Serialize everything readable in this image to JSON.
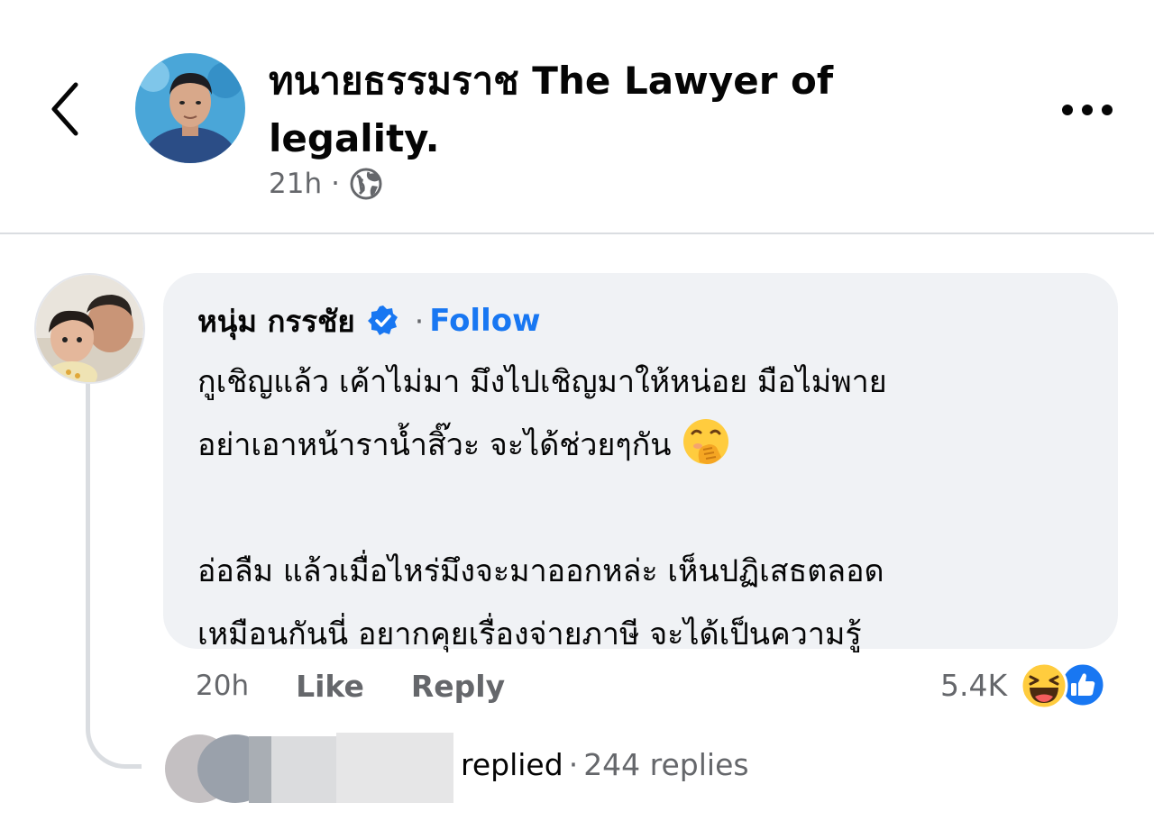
{
  "header": {
    "page_name": "ทนายธรรมราช The Lawyer of legality.",
    "time": "21h",
    "separator": "·",
    "audience_icon": "globe-icon",
    "back_icon": "chevron-left-icon",
    "more_icon": "more-horizontal-icon"
  },
  "comment": {
    "author": "หนุ่ม กรรชัย",
    "verified_icon": "verified-badge-icon",
    "separator": "·",
    "follow_label": "Follow",
    "paragraph_1": "กูเชิญแล้ว เค้าไม่มา มึงไปเชิญมาให้หน่อย มือไม่พาย\nอย่าเอาหน้าราน้ำสิ๊วะ จะได้ช่วยๆกัน",
    "emoji": "face-with-hand-over-mouth-emoji",
    "paragraph_2": "อ่อลืม แล้วเมื่อไหร่มึงจะมาออกหล่ะ เห็นปฏิเสธตลอด\nเหมือนกันนี่ อยากคุยเรื่องจ่ายภาษี จะได้เป็นความรู้",
    "time": "20h",
    "like_label": "Like",
    "reply_label": "Reply",
    "reaction_count": "5.4K",
    "reaction_icons": [
      "haha-icon",
      "like-icon"
    ]
  },
  "replies": {
    "replied_label": "replied",
    "separator": "·",
    "count_label": "244 replies"
  },
  "colors": {
    "link_blue": "#1877f2",
    "secondary_text": "#65676b",
    "bubble_bg": "#f0f2f5"
  }
}
